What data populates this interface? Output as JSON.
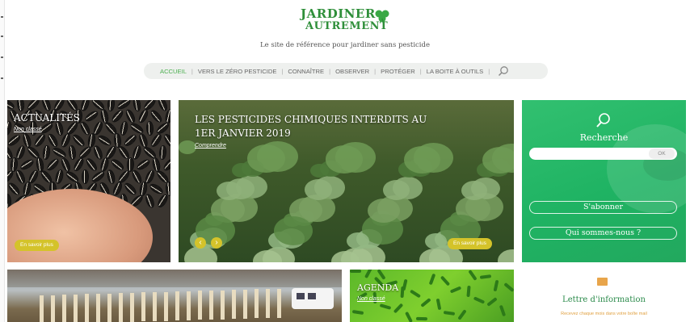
{
  "header": {
    "logo_line1": "JARDINER",
    "logo_line2": "AUTREMENT",
    "tagline": "Le site de référence pour jardiner sans pesticide"
  },
  "nav": {
    "items": [
      {
        "label": "ACCUEIL",
        "active": true
      },
      {
        "label": "VERS LE ZÉRO PESTICIDE",
        "active": false
      },
      {
        "label": "CONNAÎTRE",
        "active": false
      },
      {
        "label": "OBSERVER",
        "active": false
      },
      {
        "label": "PROTÉGER",
        "active": false
      },
      {
        "label": "LA BOITE À OUTILS",
        "active": false
      }
    ],
    "separator": "|",
    "search_icon": "search-icon"
  },
  "tiles": {
    "actualites": {
      "title": "ACTUALITÉS",
      "category": "Non classé",
      "cta": "En savoir plus"
    },
    "featured": {
      "title_line1": "LES PESTICIDES CHIMIQUES INTERDITS AU",
      "title_line2": "1ER JANVIER 2019",
      "category": "Comprendre",
      "cta": "En savoir plus",
      "prev": "‹",
      "next": "›"
    },
    "agenda": {
      "title": "AGENDA",
      "category": "Non classé"
    }
  },
  "search_panel": {
    "title": "Recherche",
    "input_value": "",
    "ok_label": "OK",
    "subscribe_label": "S'abonner",
    "about_label": "Qui sommes-nous ?"
  },
  "newsletter": {
    "title": "Lettre d'information",
    "text": "Recevez chaque mois dans votre boîte mail"
  },
  "colors": {
    "brand_green": "#2f8f3a",
    "nav_active": "#4caf50",
    "pill_yellow": "#d4c32a",
    "panel_green": "#1fb363"
  }
}
